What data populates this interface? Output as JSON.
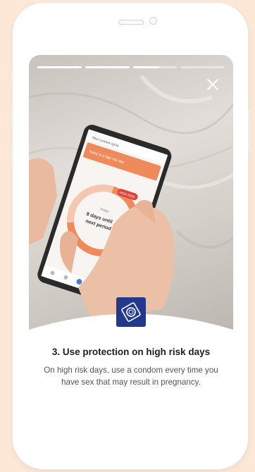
{
  "story": {
    "progress": [
      1,
      1,
      0.6,
      0
    ],
    "step_title": "3. Use protection on high risk days",
    "step_body": "On high risk days, use a condom every time you have sex that may result in pregnancy."
  },
  "photo_phone": {
    "header": "Your current cycle",
    "banner": "Today is a high risk day",
    "label": "Today",
    "days_text": "8 days until",
    "next_text": "next period",
    "badge": "HIGH RISK"
  },
  "colors": {
    "page_bg": "#fde7d7",
    "accent_orange": "#ef8a5c",
    "badge_blue": "#233a8a",
    "alert_red": "#d9473b"
  },
  "icons": {
    "close": "close-icon",
    "condom": "condom-icon"
  }
}
